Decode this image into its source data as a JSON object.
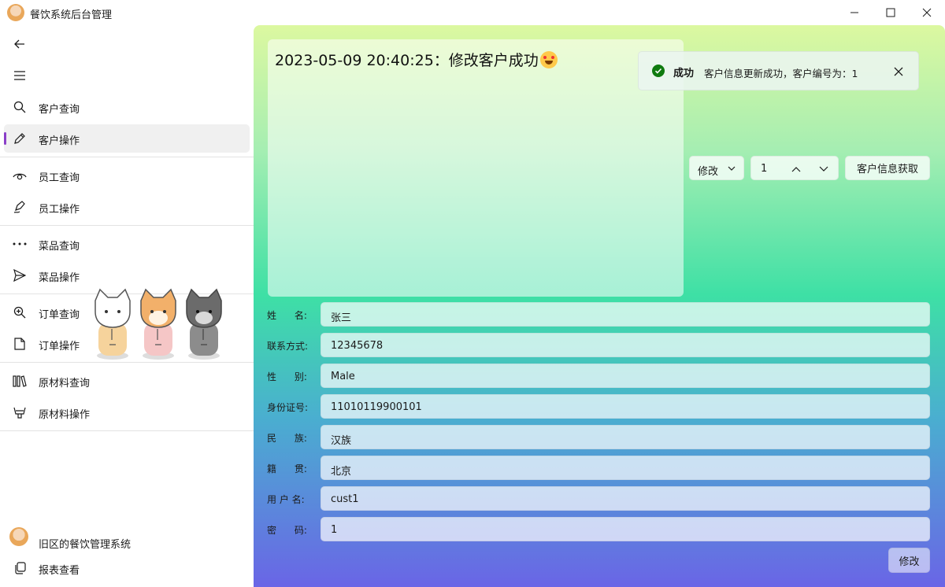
{
  "window": {
    "title": "餐饮系统后台管理"
  },
  "sidebar": {
    "items": [
      {
        "label": "客户查询",
        "icon": "search-icon"
      },
      {
        "label": "客户操作",
        "icon": "pencil-icon",
        "selected": true
      },
      {
        "label": "员工查询",
        "icon": "eye-icon"
      },
      {
        "label": "员工操作",
        "icon": "pen-icon"
      },
      {
        "label": "菜品查询",
        "icon": "more-icon"
      },
      {
        "label": "菜品操作",
        "icon": "send-icon"
      },
      {
        "label": "订单查询",
        "icon": "zoom-in-icon"
      },
      {
        "label": "订单操作",
        "icon": "document-icon"
      },
      {
        "label": "原材料查询",
        "icon": "library-icon"
      },
      {
        "label": "原材料操作",
        "icon": "basket-icon"
      }
    ],
    "footer": {
      "account_label": "旧区的餐饮管理系统",
      "report_label": "报表查看"
    }
  },
  "log": {
    "text": "2023-05-09 20:40:25：修改客户成功"
  },
  "infobar": {
    "title": "成功",
    "message": "客户信息更新成功，客户编号为：1"
  },
  "controls": {
    "mode": "修改",
    "customer_id": "1",
    "fetch_label": "客户信息获取"
  },
  "form": {
    "fields": [
      {
        "label": "姓      名:",
        "value": "张三"
      },
      {
        "label": "联系方式:",
        "value": "12345678"
      },
      {
        "label": "性      别:",
        "value": "Male"
      },
      {
        "label": "身份证号:",
        "value": "11010119900101"
      },
      {
        "label": "民      族:",
        "value": "汉族"
      },
      {
        "label": "籍      贯:",
        "value": "北京"
      },
      {
        "label": "用 户 名:",
        "value": "cust1"
      },
      {
        "label": "密      码:",
        "value": "1"
      }
    ],
    "submit_label": "修改"
  },
  "colors": {
    "accent": "#8a3fc8",
    "success": "#0f7b0f"
  }
}
